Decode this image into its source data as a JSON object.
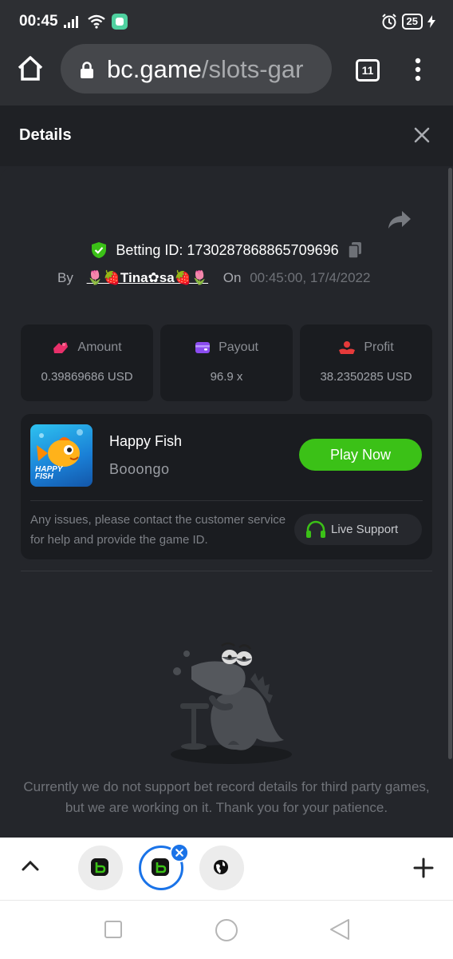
{
  "status_bar": {
    "time": "00:45",
    "battery": "25",
    "icons": [
      "signal-icon",
      "wifi-icon",
      "app-notification-icon",
      "alarm-icon",
      "battery-icon",
      "charging-icon"
    ]
  },
  "browser": {
    "url_host": "bc.game",
    "url_path": "/slots-gar",
    "tab_count": "11"
  },
  "details": {
    "title": "Details"
  },
  "bet": {
    "id_label": "Betting ID: 1730287868865709696",
    "by_label": "By",
    "username": "🌷🍓Tina✿sa🍓🌷",
    "on_label": "On",
    "datetime": "00:45:00, 17/4/2022"
  },
  "stats": {
    "amount": {
      "label": "Amount",
      "value": "0.39869686 USD"
    },
    "payout": {
      "label": "Payout",
      "value": "96.9 x"
    },
    "profit": {
      "label": "Profit",
      "value": "38.2350285 USD"
    }
  },
  "game": {
    "name": "Happy Fish",
    "provider": "Booongo",
    "thumb_text_1": "HAPPY",
    "thumb_text_2": "FISH",
    "play_label": "Play Now",
    "issue_text": "Any issues, please contact the customer service for help and provide the game ID.",
    "support_label": "Live Support"
  },
  "notice": "Currently we do not support bet record details for third party games, but we are working on it. Thank you for your patience.",
  "colors": {
    "accent_green": "#3bc117",
    "panel_bg": "#24262b",
    "card_bg": "#1a1c20",
    "tab_blue": "#1a73e8"
  }
}
